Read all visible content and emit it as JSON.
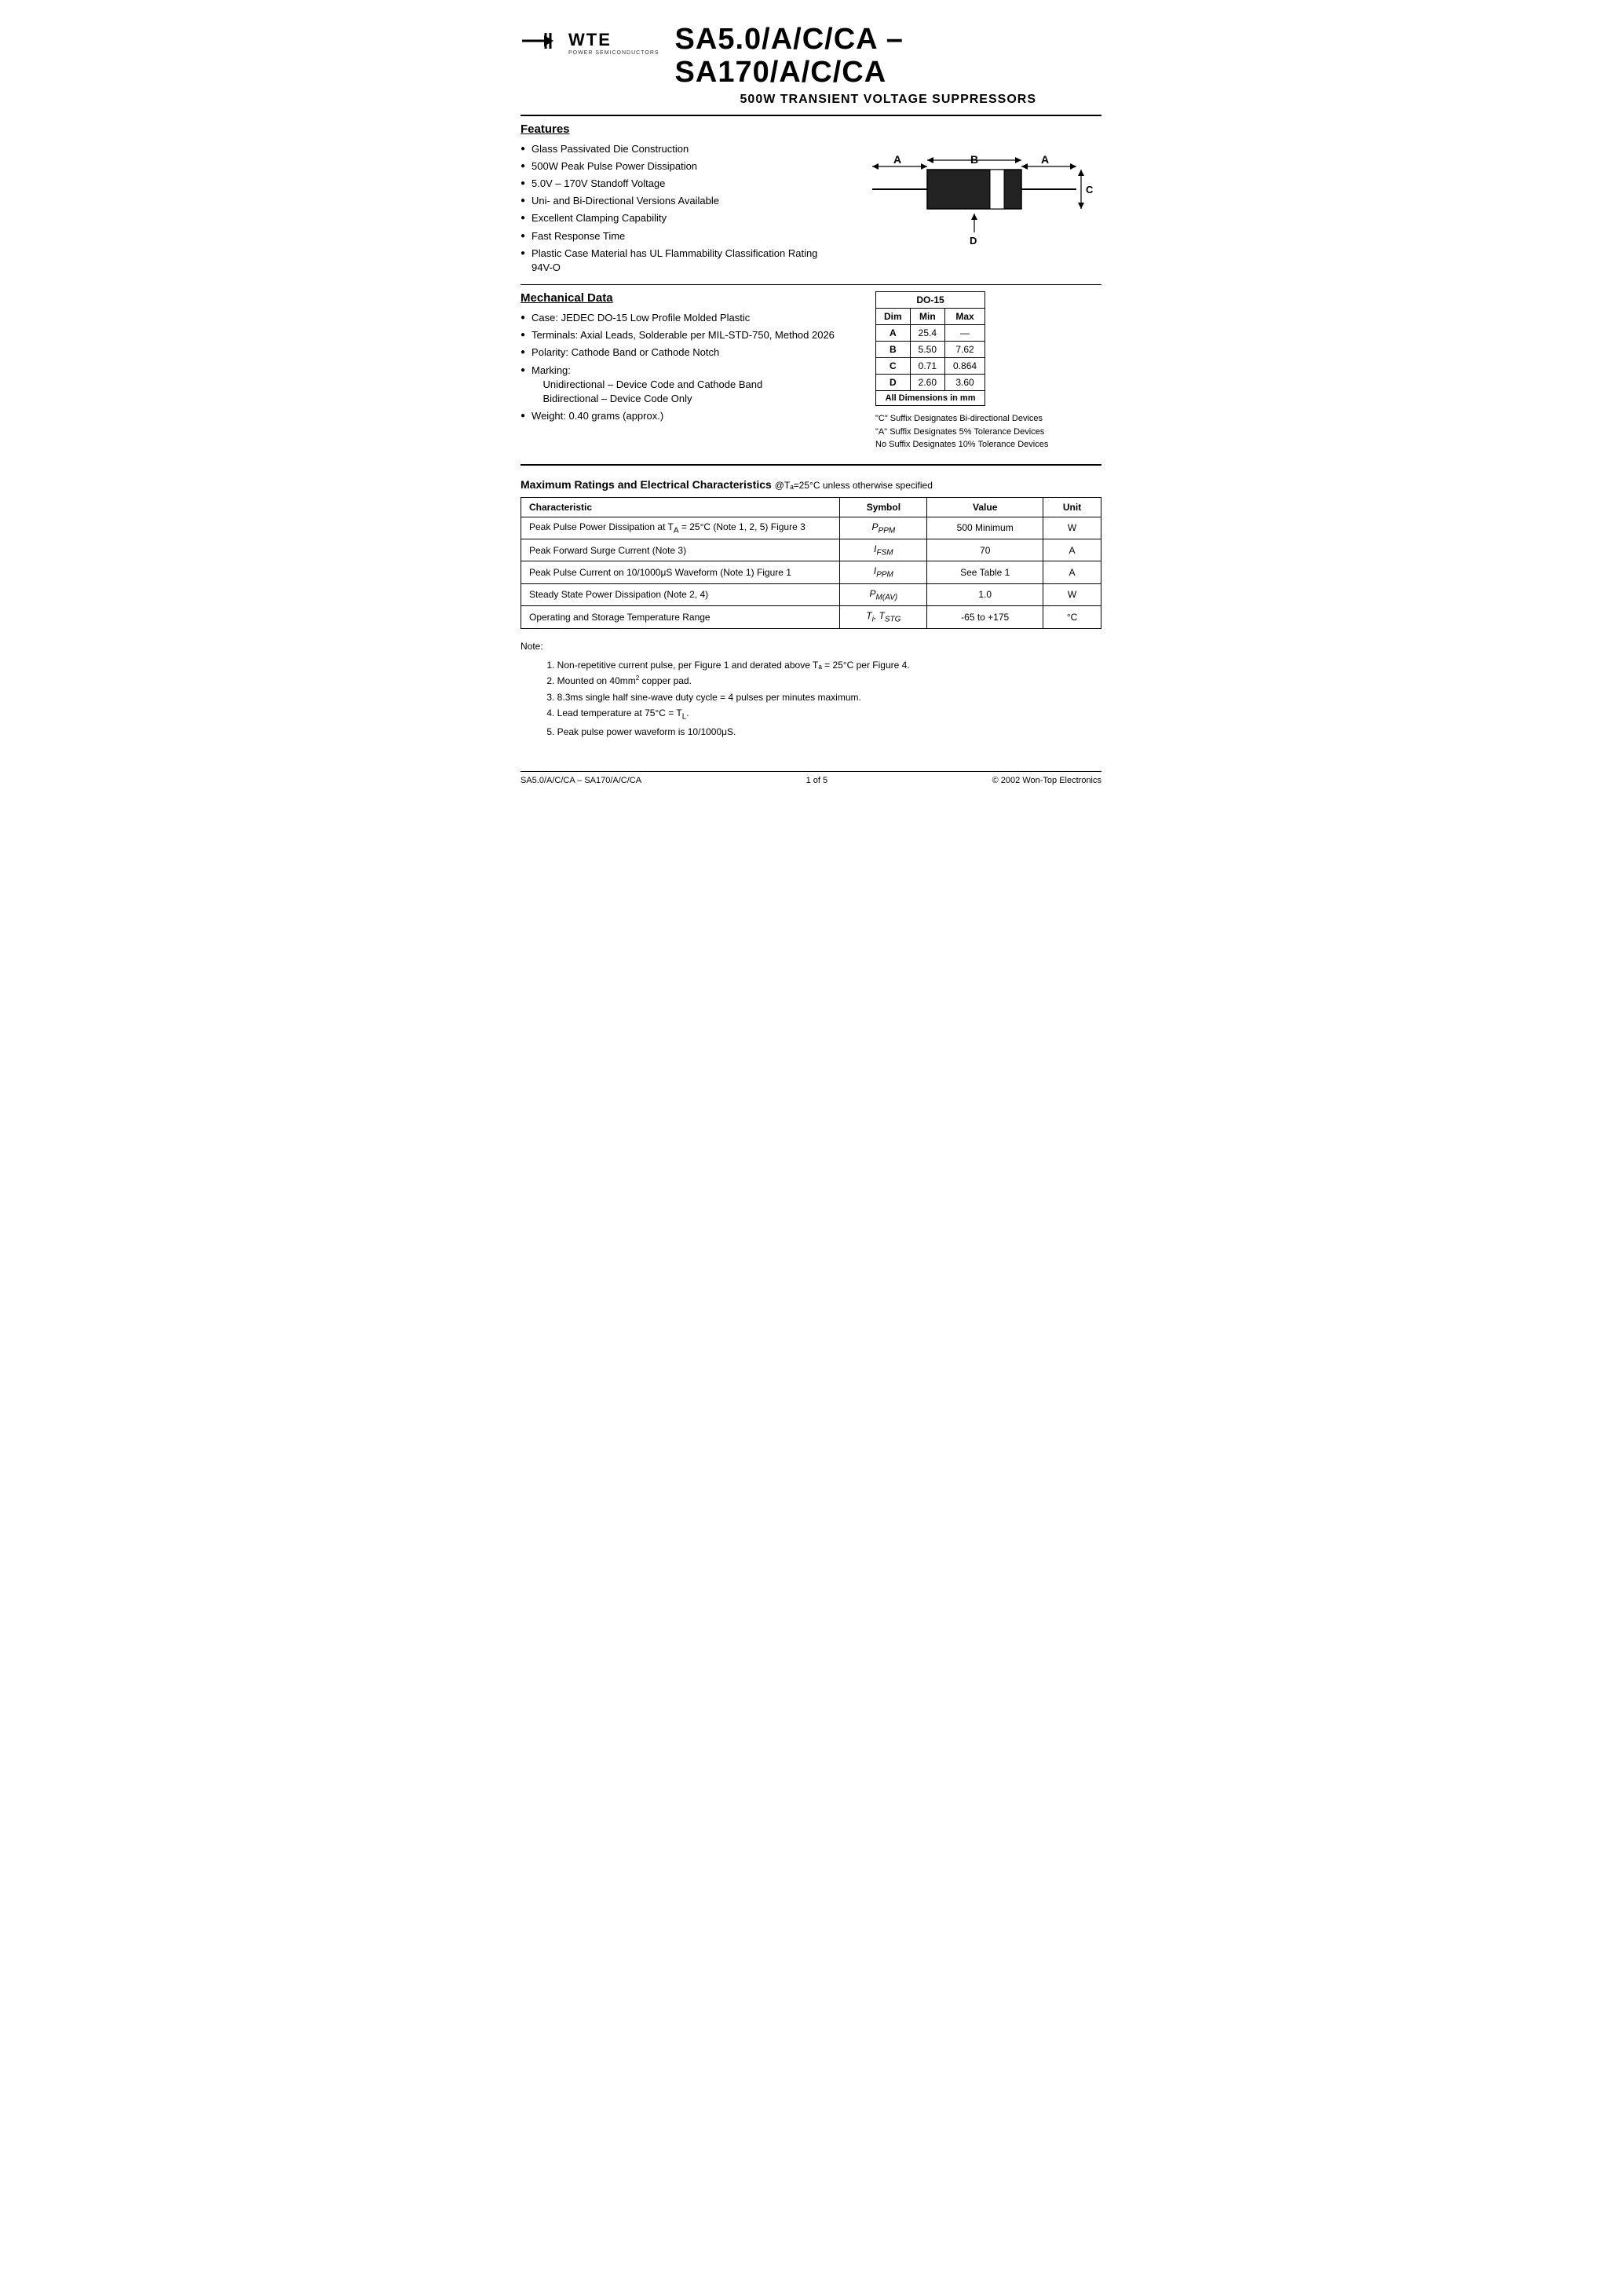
{
  "header": {
    "logo_arrow": "▶+",
    "logo_wte": "WTE",
    "logo_sub": "POWER SEMICONDUCTORS",
    "main_title": "SA5.0/A/C/CA – SA170/A/C/CA",
    "sub_title": "500W TRANSIENT VOLTAGE SUPPRESSORS"
  },
  "features": {
    "section_title": "Features",
    "items": [
      "Glass Passivated Die Construction",
      "500W Peak Pulse Power Dissipation",
      "5.0V – 170V Standoff Voltage",
      "Uni- and Bi-Directional Versions Available",
      "Excellent Clamping Capability",
      "Fast Response Time",
      "Plastic Case Material has UL Flammability Classification Rating 94V-O"
    ]
  },
  "mechanical": {
    "section_title": "Mechanical Data",
    "items": [
      "Case: JEDEC DO-15 Low Profile Molded Plastic",
      "Terminals: Axial Leads, Solderable per MIL-STD-750, Method 2026",
      "Polarity: Cathode Band or Cathode Notch",
      "Marking:",
      "Unidirectional – Device Code and Cathode Band",
      "Bidirectional – Device Code Only",
      "Weight: 0.40 grams (approx.)"
    ]
  },
  "do15_table": {
    "title": "DO-15",
    "headers": [
      "Dim",
      "Min",
      "Max"
    ],
    "rows": [
      {
        "dim": "A",
        "min": "25.4",
        "max": "—"
      },
      {
        "dim": "B",
        "min": "5.50",
        "max": "7.62"
      },
      {
        "dim": "C",
        "min": "0.71",
        "max": "0.864"
      },
      {
        "dim": "D",
        "min": "2.60",
        "max": "3.60"
      }
    ],
    "footer": "All Dimensions in mm"
  },
  "do15_footnotes": {
    "lines": [
      "\"C\" Suffix Designates Bi-directional Devices",
      "\"A\" Suffix Designates 5% Tolerance Devices",
      "No Suffix Designates 10% Tolerance Devices"
    ]
  },
  "ratings": {
    "section_title": "Maximum Ratings and Electrical Characteristics",
    "condition": "@Tₐ=25°C unless otherwise specified",
    "headers": [
      "Characteristic",
      "Symbol",
      "Value",
      "Unit"
    ],
    "rows": [
      {
        "characteristic": "Peak Pulse Power Dissipation at Tₐ = 25°C (Note 1, 2, 5) Figure 3",
        "symbol": "PPPM",
        "value": "500 Minimum",
        "unit": "W"
      },
      {
        "characteristic": "Peak Forward Surge Current (Note 3)",
        "symbol": "IFSM",
        "value": "70",
        "unit": "A"
      },
      {
        "characteristic": "Peak Pulse Current on 10/1000μS Waveform (Note 1) Figure 1",
        "symbol": "IPPM",
        "value": "See Table 1",
        "unit": "A"
      },
      {
        "characteristic": "Steady State Power Dissipation (Note 2, 4)",
        "symbol": "PM(AV)",
        "value": "1.0",
        "unit": "W"
      },
      {
        "characteristic": "Operating and Storage Temperature Range",
        "symbol": "Ti, TSTG",
        "value": "-65 to +175",
        "unit": "°C"
      }
    ]
  },
  "notes": {
    "intro": "Note:",
    "items": [
      "1. Non-repetitive current pulse, per Figure 1 and derated above Tₐ = 25°C per Figure 4.",
      "2. Mounted on 40mm² copper pad.",
      "3. 8.3ms single half sine-wave duty cycle = 4 pulses per minutes maximum.",
      "4. Lead temperature at 75°C = Tₗ.",
      "5. Peak pulse power waveform is 10/1000μS."
    ]
  },
  "footer": {
    "left": "SA5.0/A/C/CA – SA170/A/C/CA",
    "center": "1 of 5",
    "right": "© 2002 Won-Top Electronics"
  }
}
